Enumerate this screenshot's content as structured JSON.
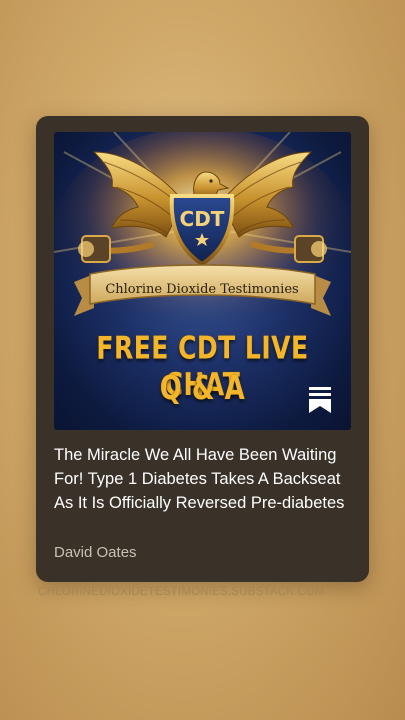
{
  "post": {
    "cover": {
      "banner_text": "Chlorine Dioxide Testimonies",
      "badge_text": "CDT",
      "headline_line1": "FREE CDT LIVE CHAT",
      "headline_line2": "Q & A"
    },
    "title": "The Miracle We All Have Been Waiting For! Type 1 Diabetes Takes A Backseat As It Is Officially Reversed Pre-diabetes",
    "author": "David Oates"
  },
  "source": {
    "domain": "CHLORINEDIOXIDETESTIMONIES.SUBSTACK.COM"
  },
  "icons": {
    "cover_corner": "substack-bookmark-icon",
    "emblem": "eagle-shield-icon"
  },
  "colors": {
    "card_background": "#3a3128",
    "headline_gold": "#f3b62a",
    "page_background": "#cfa868"
  }
}
